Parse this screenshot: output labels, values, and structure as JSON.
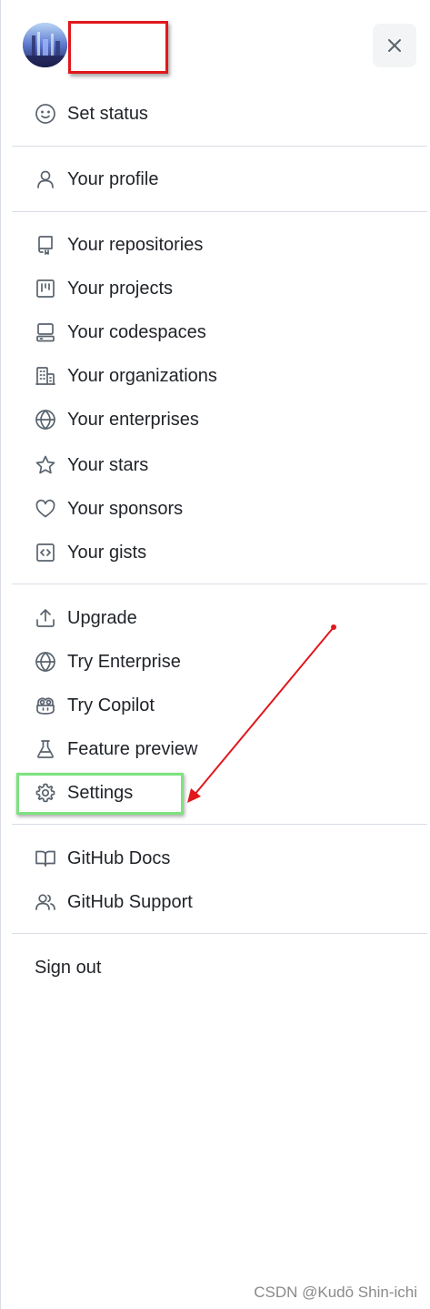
{
  "header": {
    "avatar_alt": "",
    "close_icon": "x-icon"
  },
  "menu": {
    "set_status": "Set status",
    "your_profile": "Your profile",
    "your_repositories": "Your repositories",
    "your_projects": "Your projects",
    "your_codespaces": "Your codespaces",
    "your_organizations": "Your organizations",
    "your_enterprises": "Your enterprises",
    "your_stars": "Your stars",
    "your_sponsors": "Your sponsors",
    "your_gists": "Your gists",
    "upgrade": "Upgrade",
    "try_enterprise": "Try Enterprise",
    "try_copilot": "Try Copilot",
    "feature_preview": "Feature preview",
    "settings": "Settings",
    "github_docs": "GitHub Docs",
    "github_support": "GitHub Support",
    "sign_out": "Sign out"
  },
  "annotations": {
    "highlight_color": "#7de37f",
    "arrow_color": "#e0181c",
    "redaction_border_color": "#e0181c"
  },
  "watermark": "CSDN @Kudō Shin-ichi"
}
